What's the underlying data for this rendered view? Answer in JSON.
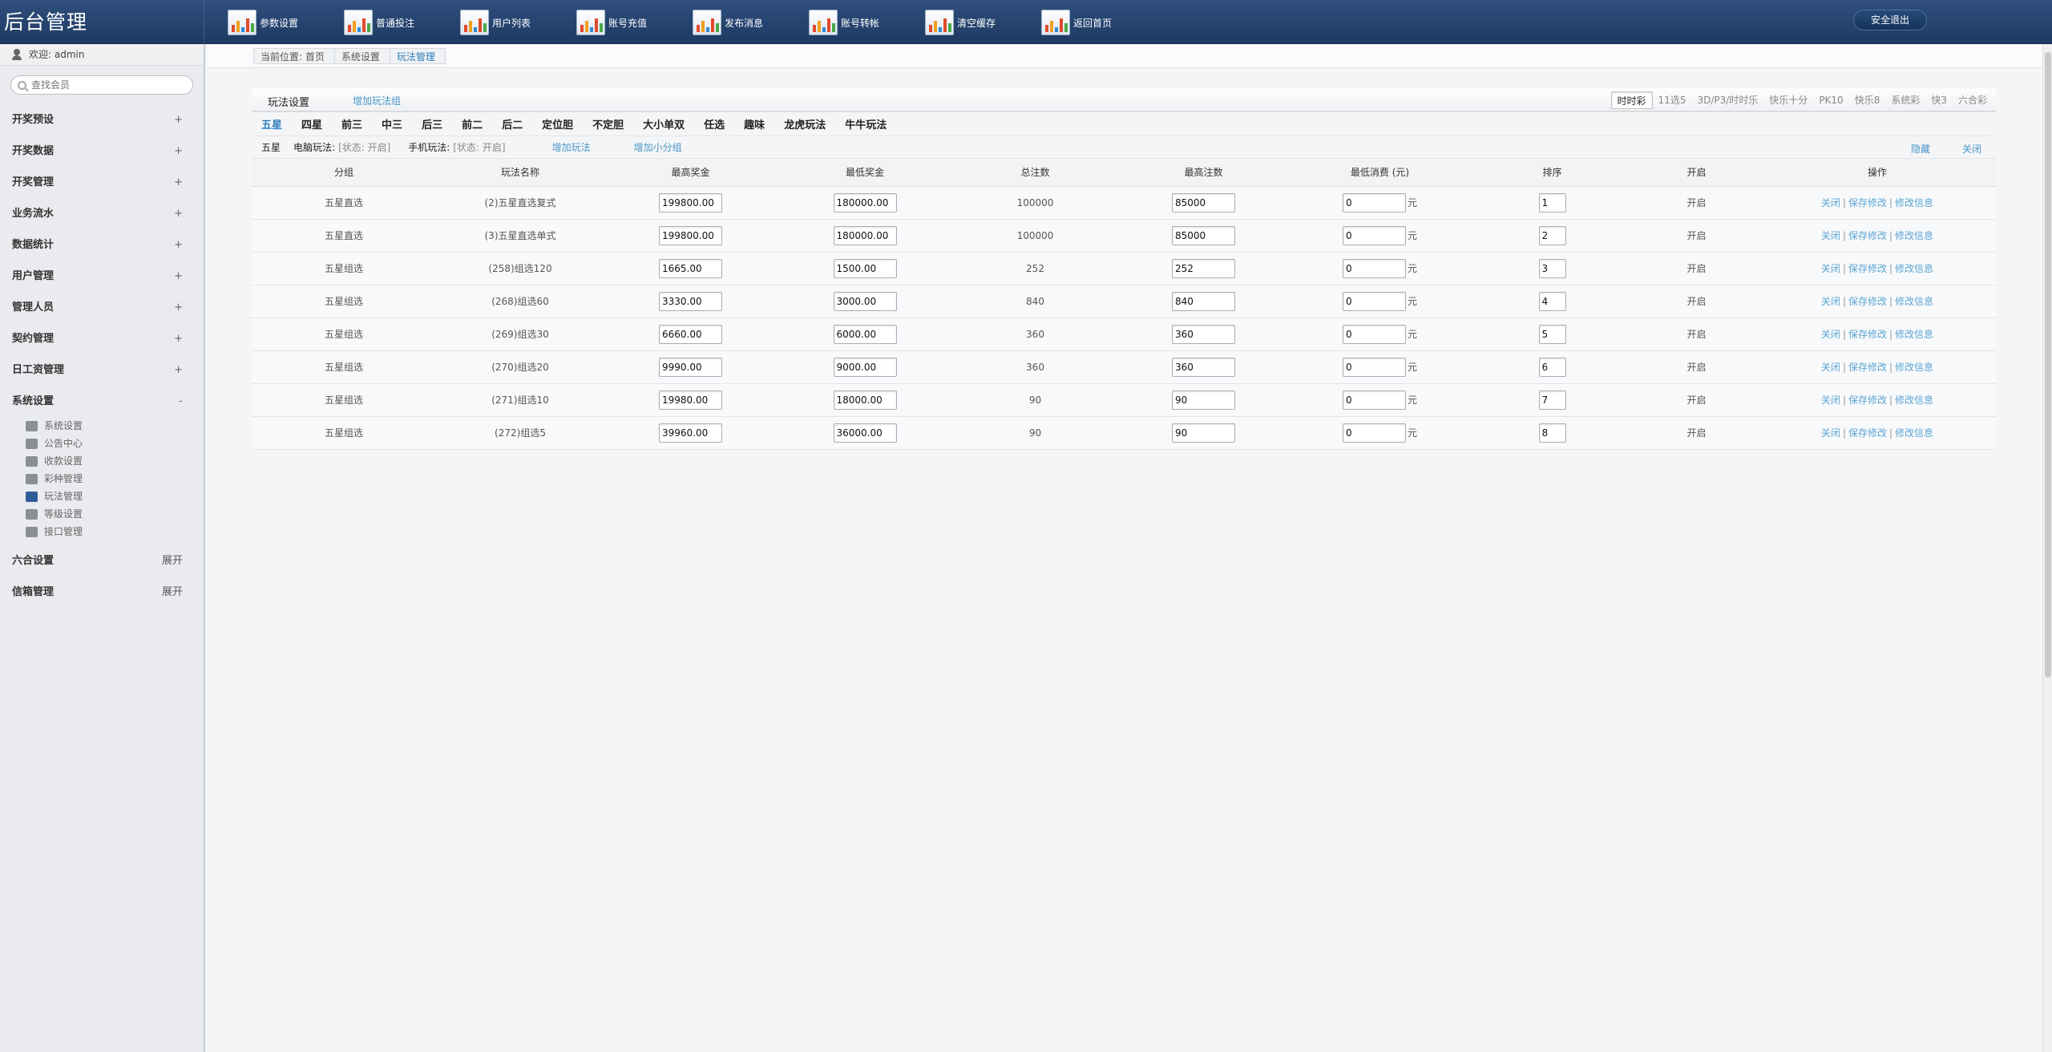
{
  "app": {
    "brand": "后台管理",
    "logout_label": "安全退出"
  },
  "topnav": [
    {
      "label": "参数设置",
      "icon": "chart-icon"
    },
    {
      "label": "普通投注",
      "icon": "chart-icon"
    },
    {
      "label": "用户列表",
      "icon": "chart-icon"
    },
    {
      "label": "账号充值",
      "icon": "chart-icon"
    },
    {
      "label": "发布消息",
      "icon": "chart-icon"
    },
    {
      "label": "账号转帐",
      "icon": "chart-icon"
    },
    {
      "label": "清空缓存",
      "icon": "chart-icon"
    },
    {
      "label": "返回首页",
      "icon": "chart-icon"
    }
  ],
  "sidebar": {
    "welcome": "欢迎: admin",
    "search_placeholder": "查找会员",
    "menu": [
      {
        "label": "开奖预设",
        "sign": "+"
      },
      {
        "label": "开奖数据",
        "sign": "+"
      },
      {
        "label": "开奖管理",
        "sign": "+"
      },
      {
        "label": "业务流水",
        "sign": "+"
      },
      {
        "label": "数据统计",
        "sign": "+"
      },
      {
        "label": "用户管理",
        "sign": "+"
      },
      {
        "label": "管理人员",
        "sign": "+"
      },
      {
        "label": "契约管理",
        "sign": "+"
      },
      {
        "label": "日工资管理",
        "sign": "+"
      },
      {
        "label": "系统设置",
        "sign": "-"
      }
    ],
    "submenu": [
      {
        "label": "系统设置",
        "icon": "wrench-icon"
      },
      {
        "label": "公告中心",
        "icon": "notice-icon"
      },
      {
        "label": "收款设置",
        "icon": "payment-icon"
      },
      {
        "label": "彩种管理",
        "icon": "lottery-icon"
      },
      {
        "label": "玩法管理",
        "icon": "gamepad-icon"
      },
      {
        "label": "等级设置",
        "icon": "levels-icon"
      },
      {
        "label": "接口管理",
        "icon": "plug-icon"
      }
    ],
    "bottom_menu": [
      {
        "label": "六合设置",
        "sign": "展开"
      },
      {
        "label": "信箱管理",
        "sign": "展开"
      }
    ]
  },
  "breadcrumb": [
    "当前位置: 首页",
    "系统设置",
    "玩法管理"
  ],
  "panel": {
    "title": "玩法设置",
    "add_group": "增加玩法组",
    "lottery_tabs": [
      "时时彩",
      "11选5",
      "3D/P3/时时乐",
      "快乐十分",
      "PK10",
      "快乐8",
      "系统彩",
      "快3",
      "六合彩"
    ],
    "active_lottery": "时时彩",
    "play_tabs": [
      "五星",
      "四星",
      "前三",
      "中三",
      "后三",
      "前二",
      "后二",
      "定位胆",
      "不定胆",
      "大小单双",
      "任选",
      "趣味",
      "龙虎玩法",
      "牛牛玩法"
    ],
    "active_play": "五星",
    "info": {
      "group": "五星",
      "pc_label": "电脑玩法:",
      "pc_state": "[状态: 开启]",
      "mobile_label": "手机玩法:",
      "mobile_state": "[状态: 开启]",
      "add_play": "增加玩法",
      "add_subgroup": "增加小分组",
      "hide": "隐藏",
      "close": "关闭"
    }
  },
  "table": {
    "headers": [
      "分组",
      "玩法名称",
      "最高奖金",
      "最低奖金",
      "总注数",
      "最高注数",
      "最低消费 (元)",
      "排序",
      "开启",
      "操作"
    ],
    "unit": "元",
    "ops": [
      "关闭",
      "保存修改",
      "修改信息"
    ],
    "rows": [
      {
        "group": "五星直选",
        "name": "(2)五星直选复式",
        "max_prize": "199800.00",
        "min_prize": "180000.00",
        "total": "100000",
        "max_bets": "85000",
        "min_cost": "0",
        "order": "1",
        "status": "开启"
      },
      {
        "group": "五星直选",
        "name": "(3)五星直选单式",
        "max_prize": "199800.00",
        "min_prize": "180000.00",
        "total": "100000",
        "max_bets": "85000",
        "min_cost": "0",
        "order": "2",
        "status": "开启"
      },
      {
        "group": "五星组选",
        "name": "(258)组选120",
        "max_prize": "1665.00",
        "min_prize": "1500.00",
        "total": "252",
        "max_bets": "252",
        "min_cost": "0",
        "order": "3",
        "status": "开启"
      },
      {
        "group": "五星组选",
        "name": "(268)组选60",
        "max_prize": "3330.00",
        "min_prize": "3000.00",
        "total": "840",
        "max_bets": "840",
        "min_cost": "0",
        "order": "4",
        "status": "开启"
      },
      {
        "group": "五星组选",
        "name": "(269)组选30",
        "max_prize": "6660.00",
        "min_prize": "6000.00",
        "total": "360",
        "max_bets": "360",
        "min_cost": "0",
        "order": "5",
        "status": "开启"
      },
      {
        "group": "五星组选",
        "name": "(270)组选20",
        "max_prize": "9990.00",
        "min_prize": "9000.00",
        "total": "360",
        "max_bets": "360",
        "min_cost": "0",
        "order": "6",
        "status": "开启"
      },
      {
        "group": "五星组选",
        "name": "(271)组选10",
        "max_prize": "19980.00",
        "min_prize": "18000.00",
        "total": "90",
        "max_bets": "90",
        "min_cost": "0",
        "order": "7",
        "status": "开启"
      },
      {
        "group": "五星组选",
        "name": "(272)组选5",
        "max_prize": "39960.00",
        "min_prize": "36000.00",
        "total": "90",
        "max_bets": "90",
        "min_cost": "0",
        "order": "8",
        "status": "开启"
      }
    ]
  }
}
